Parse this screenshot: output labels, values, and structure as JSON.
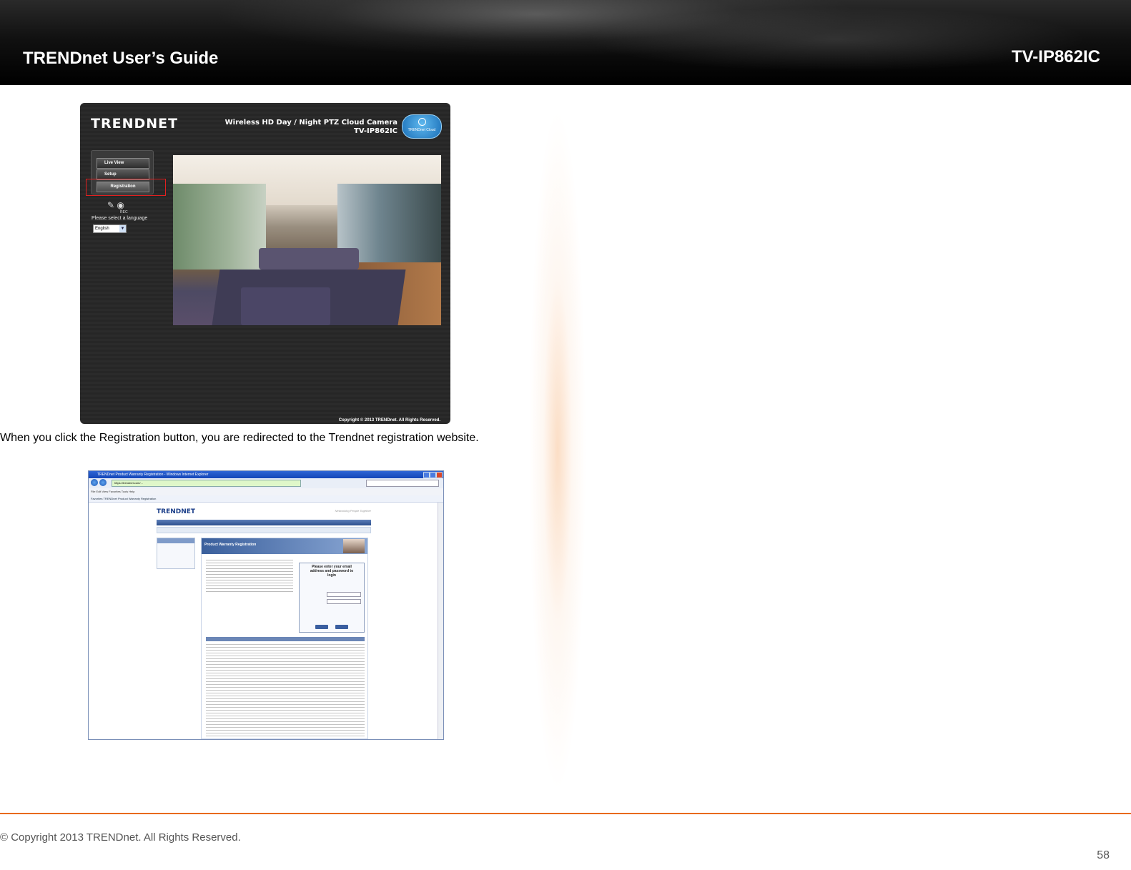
{
  "header": {
    "guide_title": "TRENDnet User’s Guide",
    "model": "TV-IP862IC"
  },
  "camera_ui": {
    "logo": "TRENDNET",
    "product_title_line1": "Wireless HD Day / Night PTZ Cloud Camera",
    "product_title_line2": "TV-IP862IC",
    "cloud_badge": "TRENDnet Cloud",
    "menu": {
      "live_view": "Live View",
      "setup": "Setup",
      "registration": "Registration"
    },
    "rec_label": "REC",
    "language_prompt": "Please select a language",
    "language_value": "English",
    "copyright": "Copyright © 2013 TRENDnet. All Rights Reserved."
  },
  "body": {
    "paragraph": "When you click the Registration button, you are redirected to the Trendnet registration website."
  },
  "browser": {
    "window_title": "TRENDnet Product Warranty Registration - Windows Internet Explorer",
    "url": "https://trendnet.com/...",
    "menu_items": "File   Edit   View   Favorites   Tools   Help",
    "favorites_tab": "Favorites    TRENDnet Product Warranty Registration",
    "site_logo": "TRENDNET",
    "site_tagline": "Networking People Together",
    "page_banner": "Product Warranty Registration",
    "login_heading": "Please enter your email address and password to login"
  },
  "footer": {
    "copyright": "© Copyright 2013 TRENDnet. All Rights Reserved.",
    "page_number": "58"
  }
}
